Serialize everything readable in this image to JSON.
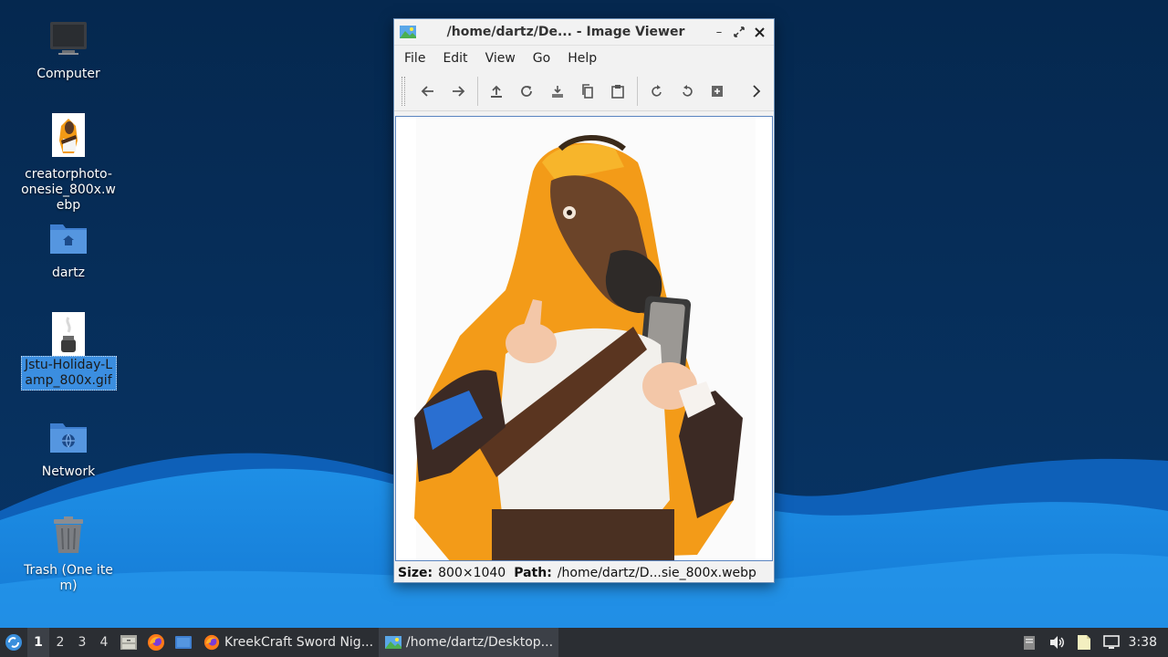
{
  "desktop": {
    "icons": [
      {
        "label": "Computer",
        "icon": "computer-icon"
      },
      {
        "label": "creatorphoto-onesie_800x.webp",
        "icon": "image-file-icon"
      },
      {
        "label": "dartz",
        "icon": "home-folder-icon"
      },
      {
        "label": "Jstu-Holiday-Lamp_800x.gif",
        "icon": "image-file-icon",
        "selected": true
      },
      {
        "label": "Network",
        "icon": "network-folder-icon"
      },
      {
        "label": "Trash (One item)",
        "icon": "trash-icon"
      }
    ]
  },
  "window": {
    "title": "/home/dartz/De...  - Image Viewer",
    "menu": [
      "File",
      "Edit",
      "View",
      "Go",
      "Help"
    ],
    "toolbar": [
      "back-icon",
      "forward-icon",
      "upload-icon",
      "reload-icon",
      "save-icon",
      "copy-icon",
      "paste-icon",
      "rotate-cw-icon",
      "rotate-ccw-icon",
      "zoom-fit-icon",
      "more-icon"
    ],
    "status": {
      "size_label": "Size:",
      "size_value": "800×1040",
      "path_label": "Path:",
      "path_value": "/home/dartz/D...sie_800x.webp"
    }
  },
  "taskbar": {
    "workspaces": [
      "1",
      "2",
      "3",
      "4"
    ],
    "active_workspace": "1",
    "tasks": [
      {
        "label": "KreekCraft Sword Nig...",
        "icon": "firefox-icon"
      },
      {
        "label": "/home/dartz/Desktop...",
        "icon": "image-viewer-icon",
        "active": true
      }
    ],
    "clock": "3:38"
  },
  "colors": {
    "wallpaper_dark": "#062a52",
    "wallpaper_light": "#1e8fe6",
    "taskbar": "#2b2e33",
    "selection": "#3b8ee0"
  }
}
